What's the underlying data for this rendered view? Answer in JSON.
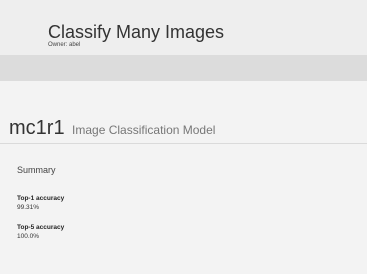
{
  "header": {
    "title": "Classify Many Images",
    "owner": "Owner: abel"
  },
  "model": {
    "name": "mc1r1",
    "type": "Image Classification Model"
  },
  "summary": {
    "title": "Summary",
    "metrics": [
      {
        "label": "Top-1 accuracy",
        "value": "99.31%"
      },
      {
        "label": "Top-5 accuracy",
        "value": "100.0%"
      }
    ]
  }
}
